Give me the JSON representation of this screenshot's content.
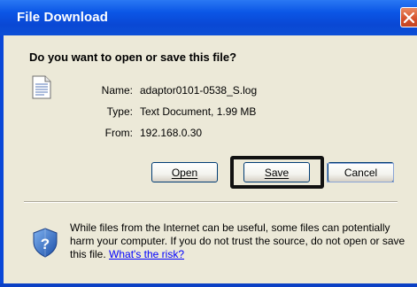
{
  "window": {
    "title": "File Download"
  },
  "dialog": {
    "heading": "Do you want to open or save this file?",
    "fields": {
      "name_label": "Name:",
      "name_value": "adaptor0101-0538_S.log",
      "type_label": "Type:",
      "type_value": "Text Document, 1.99 MB",
      "from_label": "From:",
      "from_value": "192.168.0.30"
    },
    "buttons": {
      "open": "Open",
      "save": "Save",
      "cancel": "Cancel"
    },
    "warning": {
      "text": "While files from the Internet can be useful, some files can potentially harm your computer. If you do not trust the source, do not open or save this file.",
      "link": "What's the risk?"
    }
  },
  "icons": {
    "document": "text-document-icon",
    "shield": "security-shield-icon",
    "close": "close-icon"
  },
  "colors": {
    "titlebar": "#0a4ee0",
    "client": "#ece9d8",
    "close_button": "#d4502b",
    "link": "#0000ff",
    "highlight_box": "#111111"
  }
}
